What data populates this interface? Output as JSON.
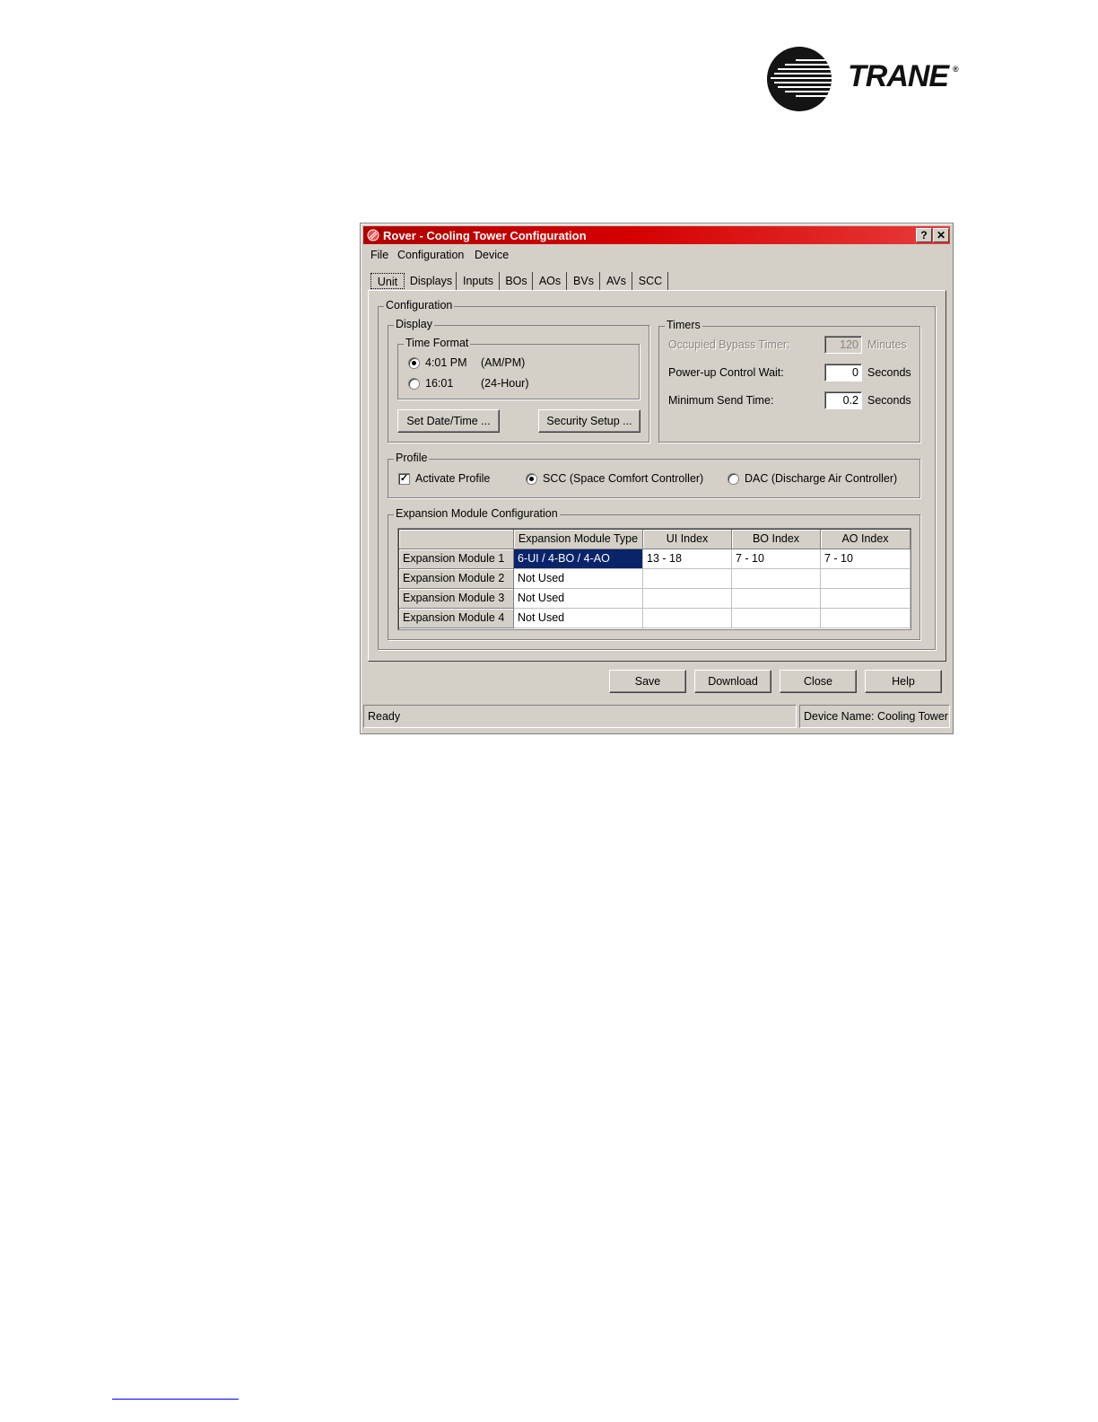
{
  "brand": {
    "name": "TRANE",
    "registered": "®"
  },
  "window": {
    "title": "Rover - Cooling Tower Configuration",
    "help_label": "?",
    "close_label": "✕"
  },
  "menu": [
    "File",
    "Configuration",
    "Device"
  ],
  "tabs": [
    "Unit",
    "Displays",
    "Inputs",
    "BOs",
    "AOs",
    "BVs",
    "AVs",
    "SCC"
  ],
  "configuration": {
    "label": "Configuration",
    "display": {
      "label": "Display",
      "time_format": {
        "label": "Time Format",
        "options": [
          {
            "time": "4:01 PM",
            "desc": "(AM/PM)",
            "selected": true
          },
          {
            "time": "16:01",
            "desc": "(24-Hour)",
            "selected": false
          }
        ]
      },
      "set_datetime_label": "Set Date/Time ...",
      "security_setup_label": "Security Setup ..."
    },
    "timers": {
      "label": "Timers",
      "rows": [
        {
          "label": "Occupied Bypass Timer:",
          "value": "120",
          "unit": "Minutes",
          "enabled": false
        },
        {
          "label": "Power-up Control Wait:",
          "value": "0",
          "unit": "Seconds",
          "enabled": true
        },
        {
          "label": "Minimum Send Time:",
          "value": "0.2",
          "unit": "Seconds",
          "enabled": true
        }
      ]
    },
    "profile": {
      "label": "Profile",
      "activate_label": "Activate Profile",
      "activate_checked": true,
      "scc_label": "SCC (Space Comfort Controller)",
      "dac_label": "DAC (Discharge Air Controller)",
      "selected": "SCC"
    },
    "expansion": {
      "label": "Expansion Module Configuration",
      "columns": [
        "",
        "Expansion Module Type",
        "UI Index",
        "BO Index",
        "AO Index"
      ],
      "rows": [
        {
          "name": "Expansion Module 1",
          "type": "6-UI / 4-BO / 4-AO",
          "ui": "13 - 18",
          "bo": "7 - 10",
          "ao": "7 - 10"
        },
        {
          "name": "Expansion Module 2",
          "type": "Not Used",
          "ui": "",
          "bo": "",
          "ao": ""
        },
        {
          "name": "Expansion Module 3",
          "type": "Not Used",
          "ui": "",
          "bo": "",
          "ao": ""
        },
        {
          "name": "Expansion Module 4",
          "type": "Not Used",
          "ui": "",
          "bo": "",
          "ao": ""
        }
      ]
    }
  },
  "buttons": {
    "save": "Save",
    "download": "Download",
    "close": "Close",
    "help": "Help"
  },
  "status": {
    "left": "Ready",
    "right": "Device Name: Cooling Tower"
  },
  "colors": {
    "titlebar": "#d40000",
    "face": "#d4d0c8",
    "selection": "#0a246a"
  }
}
